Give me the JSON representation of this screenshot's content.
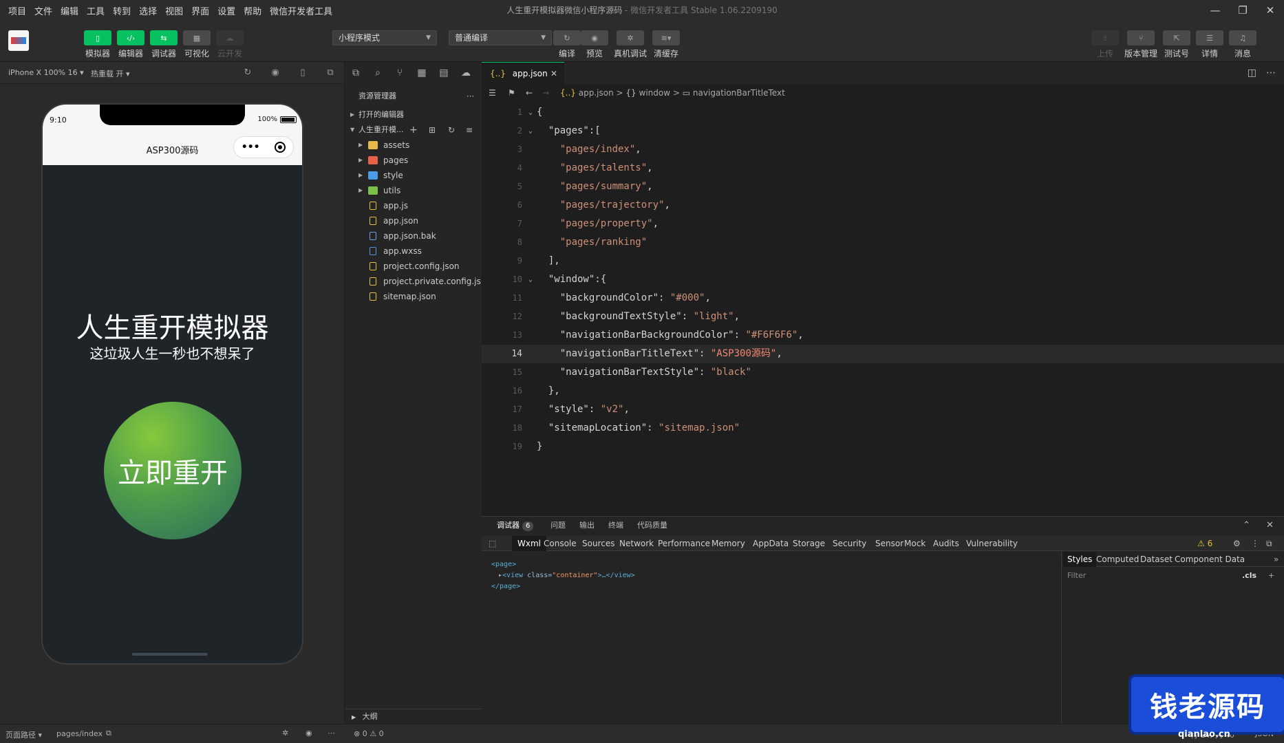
{
  "menubar": {
    "items": [
      "项目",
      "文件",
      "编辑",
      "工具",
      "转到",
      "选择",
      "视图",
      "界面",
      "设置",
      "帮助",
      "微信开发者工具"
    ]
  },
  "window": {
    "title": "人生重开模拟器微信小程序源码",
    "subtitle": "- 微信开发者工具 Stable 1.06.2209190",
    "minimize": "—",
    "restore": "❐",
    "close": "✕"
  },
  "toolbar": {
    "left": [
      {
        "label": "模拟器",
        "icon": "phone-icon"
      },
      {
        "label": "编辑器",
        "icon": "code-icon"
      },
      {
        "label": "调试器",
        "icon": "debug-icon"
      },
      {
        "label": "可视化",
        "icon": "layout-icon"
      },
      {
        "label": "云开发",
        "icon": "cloud-icon"
      }
    ],
    "mode_select": "小程序模式",
    "compile_select": "普通编译",
    "mid": [
      {
        "label": "编译",
        "icon": "refresh-icon"
      },
      {
        "label": "预览",
        "icon": "eye-icon"
      },
      {
        "label": "真机调试",
        "icon": "bug-icon"
      },
      {
        "label": "清缓存",
        "icon": "layers-icon"
      }
    ],
    "right": [
      {
        "label": "上传",
        "icon": "upload-icon"
      },
      {
        "label": "版本管理",
        "icon": "branch-icon"
      },
      {
        "label": "测试号",
        "icon": "external-icon"
      },
      {
        "label": "详情",
        "icon": "menu-icon"
      },
      {
        "label": "消息",
        "icon": "bell-icon"
      }
    ]
  },
  "simulator": {
    "device": "iPhone X 100% 16 ▾",
    "hotreload": "热重载 开 ▾",
    "time": "9:10",
    "battery": "100%",
    "nav_title": "ASP300源码",
    "capsule_dots": "•••",
    "title": "人生重开模拟器",
    "subtitle": "这垃圾人生一秒也不想呆了",
    "button": "立即重开"
  },
  "status_left": {
    "path_label": "页面路径 ▾",
    "path": "pages/index"
  },
  "explorer": {
    "header": "资源管理器",
    "open_editors": "打开的编辑器",
    "project": "人生重开模...",
    "items": [
      {
        "name": "assets",
        "type": "folder",
        "color": "#e8b84a"
      },
      {
        "name": "pages",
        "type": "folder",
        "color": "#e8624a"
      },
      {
        "name": "style",
        "type": "folder",
        "color": "#4a9be8"
      },
      {
        "name": "utils",
        "type": "folder",
        "color": "#7cc04a"
      },
      {
        "name": "app.js",
        "type": "file",
        "icon": "js-icon",
        "color": "#e8c03a"
      },
      {
        "name": "app.json",
        "type": "file",
        "icon": "json-icon",
        "color": "#e8c03a"
      },
      {
        "name": "app.json.bak",
        "type": "file",
        "icon": "file-icon",
        "color": "#6a9be8"
      },
      {
        "name": "app.wxss",
        "type": "file",
        "icon": "css-icon",
        "color": "#4a9be8"
      },
      {
        "name": "project.config.json",
        "type": "file",
        "icon": "json-icon",
        "color": "#e8c03a"
      },
      {
        "name": "project.private.config.js...",
        "type": "file",
        "icon": "json-icon",
        "color": "#e8c03a"
      },
      {
        "name": "sitemap.json",
        "type": "file",
        "icon": "json-icon",
        "color": "#e8c03a"
      }
    ],
    "outline": "大纲"
  },
  "status_mid": {
    "errors": "0",
    "warnings": "0"
  },
  "editor": {
    "tab": "app.json",
    "breadcrumb": {
      "file": "app.json",
      "sep1": ">",
      "obj": "window",
      "sep2": ">",
      "key": "navigationBarTitleText"
    },
    "lines": [
      {
        "n": "1",
        "tokens": [
          {
            "t": "{",
            "c": "p"
          }
        ]
      },
      {
        "n": "2",
        "tokens": [
          {
            "t": "  \"pages\"",
            "c": "k"
          },
          {
            "t": ":[",
            "c": "p"
          }
        ]
      },
      {
        "n": "3",
        "tokens": [
          {
            "t": "    \"pages/index\"",
            "c": "s"
          },
          {
            "t": ",",
            "c": "p"
          }
        ]
      },
      {
        "n": "4",
        "tokens": [
          {
            "t": "    \"pages/talents\"",
            "c": "s"
          },
          {
            "t": ",",
            "c": "p"
          }
        ]
      },
      {
        "n": "5",
        "tokens": [
          {
            "t": "    \"pages/summary\"",
            "c": "s"
          },
          {
            "t": ",",
            "c": "p"
          }
        ]
      },
      {
        "n": "6",
        "tokens": [
          {
            "t": "    \"pages/trajectory\"",
            "c": "s"
          },
          {
            "t": ",",
            "c": "p"
          }
        ]
      },
      {
        "n": "7",
        "tokens": [
          {
            "t": "    \"pages/property\"",
            "c": "s"
          },
          {
            "t": ",",
            "c": "p"
          }
        ]
      },
      {
        "n": "8",
        "tokens": [
          {
            "t": "    \"pages/ranking\"",
            "c": "s"
          }
        ]
      },
      {
        "n": "9",
        "tokens": [
          {
            "t": "  ],",
            "c": "p"
          }
        ]
      },
      {
        "n": "10",
        "tokens": [
          {
            "t": "  \"window\"",
            "c": "k"
          },
          {
            "t": ":{",
            "c": "p"
          }
        ]
      },
      {
        "n": "11",
        "tokens": [
          {
            "t": "    \"backgroundColor\"",
            "c": "k"
          },
          {
            "t": ": ",
            "c": "p"
          },
          {
            "t": "\"#000\"",
            "c": "s"
          },
          {
            "t": ",",
            "c": "p"
          }
        ]
      },
      {
        "n": "12",
        "tokens": [
          {
            "t": "    \"backgroundTextStyle\"",
            "c": "k"
          },
          {
            "t": ": ",
            "c": "p"
          },
          {
            "t": "\"light\"",
            "c": "s"
          },
          {
            "t": ",",
            "c": "p"
          }
        ]
      },
      {
        "n": "13",
        "tokens": [
          {
            "t": "    \"navigationBarBackgroundColor\"",
            "c": "k"
          },
          {
            "t": ": ",
            "c": "p"
          },
          {
            "t": "\"#F6F6F6\"",
            "c": "s"
          },
          {
            "t": ",",
            "c": "p"
          }
        ]
      },
      {
        "n": "14",
        "tokens": [
          {
            "t": "    \"navigationBarTitleText\"",
            "c": "k"
          },
          {
            "t": ": ",
            "c": "p"
          },
          {
            "t": "\"ASP300源码\"",
            "c": "str"
          },
          {
            "t": ",",
            "c": "p"
          }
        ],
        "active": true
      },
      {
        "n": "15",
        "tokens": [
          {
            "t": "    \"navigationBarTextStyle\"",
            "c": "k"
          },
          {
            "t": ": ",
            "c": "p"
          },
          {
            "t": "\"black\"",
            "c": "s"
          }
        ]
      },
      {
        "n": "16",
        "tokens": [
          {
            "t": "  },",
            "c": "p"
          }
        ]
      },
      {
        "n": "17",
        "tokens": [
          {
            "t": "  \"style\"",
            "c": "k"
          },
          {
            "t": ": ",
            "c": "p"
          },
          {
            "t": "\"v2\"",
            "c": "s"
          },
          {
            "t": ",",
            "c": "p"
          }
        ]
      },
      {
        "n": "18",
        "tokens": [
          {
            "t": "  \"sitemapLocation\"",
            "c": "k"
          },
          {
            "t": ": ",
            "c": "p"
          },
          {
            "t": "\"sitemap.json\"",
            "c": "s"
          }
        ]
      },
      {
        "n": "19",
        "tokens": [
          {
            "t": "}",
            "c": "p"
          }
        ]
      }
    ]
  },
  "devtools": {
    "top_tabs": [
      "调试器",
      "问题",
      "输出",
      "终端",
      "代码质量"
    ],
    "debugger_badge": "6",
    "nav": [
      "Wxml",
      "Console",
      "Sources",
      "Network",
      "Performance",
      "Memory",
      "AppData",
      "Storage",
      "Security",
      "Sensor",
      "Mock",
      "Audits",
      "Vulnerability"
    ],
    "warn_count": "⚠ 6",
    "wxml": {
      "open": "<page>",
      "view_open": "<view ",
      "attr": "class=",
      "val": "\"container\"",
      "view_rest": ">…</view>",
      "close": "</page>"
    },
    "side_tabs": [
      "Styles",
      "Computed",
      "Dataset",
      "Component Data"
    ],
    "filter": "Filter",
    "cls": ".cls"
  },
  "status_right": {
    "position": "行 14, 列 40",
    "lang": "JSON"
  },
  "watermark": {
    "text": "钱老源码",
    "url": "qianlao.cn"
  },
  "colors": {
    "accent": "#07c160",
    "bg": "#2c2c2c",
    "editor_bg": "#1e1e1e"
  }
}
